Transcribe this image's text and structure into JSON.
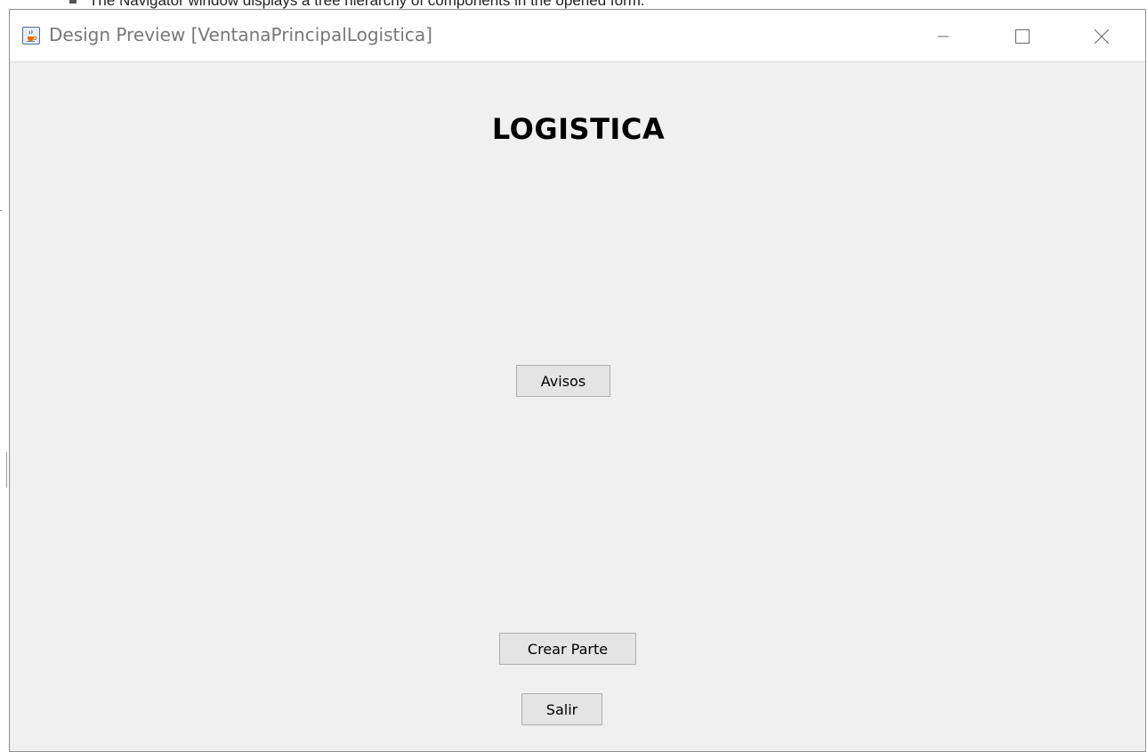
{
  "background": {
    "partial_text": "The Navigator window displays a tree hierarchy of components in the opened form."
  },
  "window": {
    "title": "Design Preview [VentanaPrincipalLogistica]",
    "icon": "java-cup-icon",
    "controls": {
      "minimize_icon": "minimize-icon",
      "maximize_icon": "maximize-icon",
      "close_icon": "close-icon"
    }
  },
  "form": {
    "heading": "LOGISTICA",
    "buttons": {
      "avisos": "Avisos",
      "crear_parte": "Crear Parte",
      "salir": "Salir"
    }
  },
  "colors": {
    "window_background": "#f0f0f0",
    "title_text": "#777777",
    "button_background": "#e4e4e4",
    "button_border": "#adadad"
  }
}
